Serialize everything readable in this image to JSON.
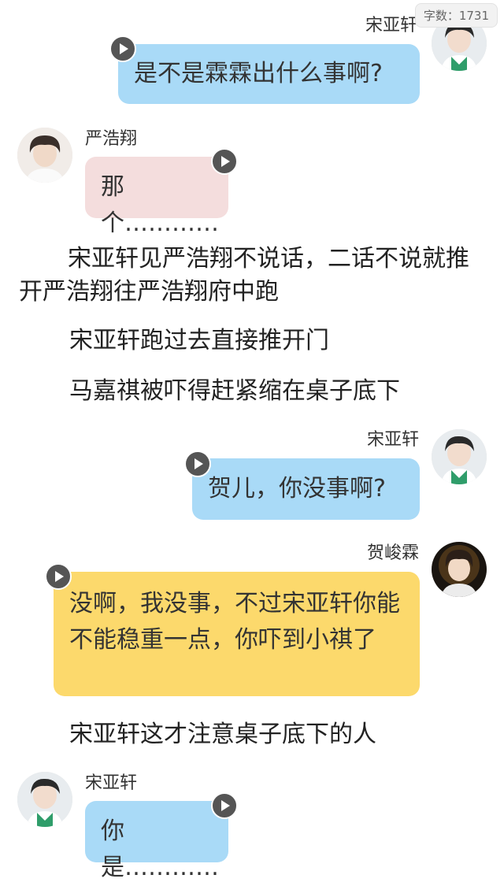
{
  "word_count": "字数：1731",
  "messages": [
    {
      "name": "宋亚轩",
      "text": "是不是霖霖出什么事啊?"
    },
    {
      "name": "严浩翔",
      "text": "那个…………"
    },
    {
      "name": "宋亚轩",
      "text": "贺儿，你没事啊?"
    },
    {
      "name": "贺峻霖",
      "text": "没啊，我没事，不过宋亚轩你能不能稳重一点，你吓到小祺了"
    },
    {
      "name": "宋亚轩",
      "text": "你是…………"
    }
  ],
  "narrations": [
    "宋亚轩见严浩翔不说话，二话不说就推开严浩翔往严浩翔府中跑",
    "宋亚轩跑过去直接推开门",
    "马嘉祺被吓得赶紧缩在桌子底下",
    "宋亚轩这才注意桌子底下的人"
  ],
  "icons": {
    "play": "play-icon",
    "avatar": "avatar-photo"
  },
  "colors": {
    "blue_bubble": "#a9daf7",
    "pink_bubble": "#f4dddd",
    "yellow_bubble": "#fcd96c"
  }
}
